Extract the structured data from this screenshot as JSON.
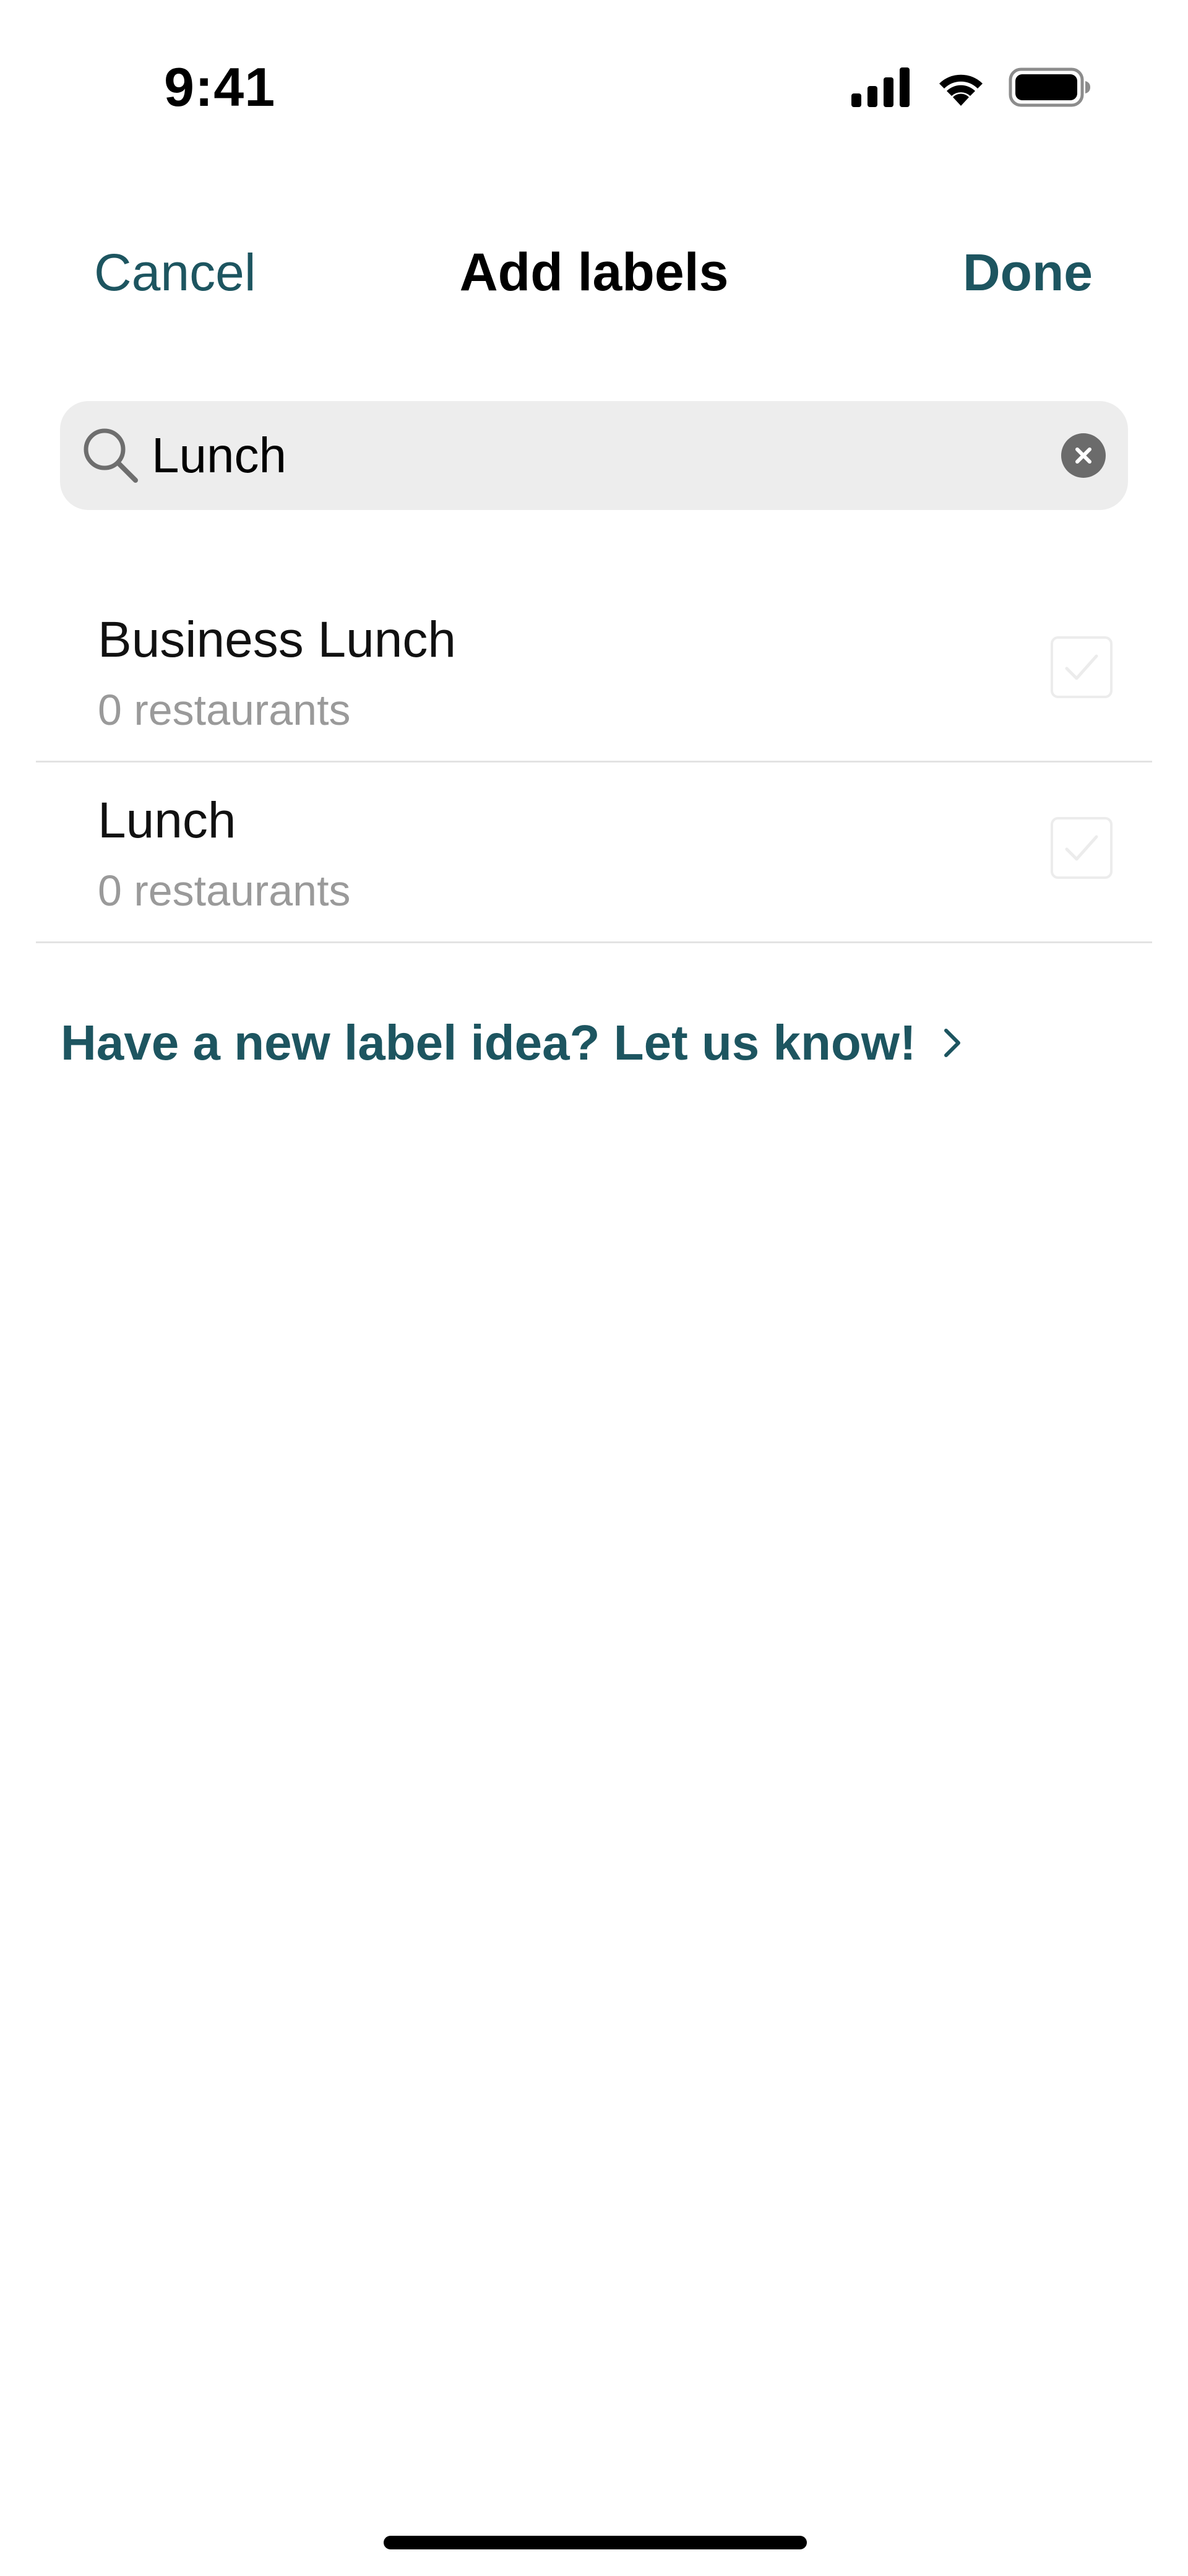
{
  "status_bar": {
    "time": "9:41",
    "icons": [
      "signal-icon",
      "wifi-icon",
      "battery-icon"
    ]
  },
  "nav": {
    "cancel_label": "Cancel",
    "title": "Add labels",
    "done_label": "Done"
  },
  "search": {
    "value": "Lunch",
    "icon": "search-icon",
    "clear_icon": "clear-icon"
  },
  "labels": [
    {
      "name": "Business Lunch",
      "count": "0 restaurants",
      "checked": false
    },
    {
      "name": "Lunch",
      "count": "0 restaurants",
      "checked": false
    }
  ],
  "feedback": {
    "text": "Have a new label idea? Let us know!",
    "icon": "chevron-right-icon"
  },
  "colors": {
    "accent": "#1d5560",
    "search_bg": "#ededed",
    "secondary_text": "#9a9a9a",
    "divider": "#e3e3e3"
  }
}
